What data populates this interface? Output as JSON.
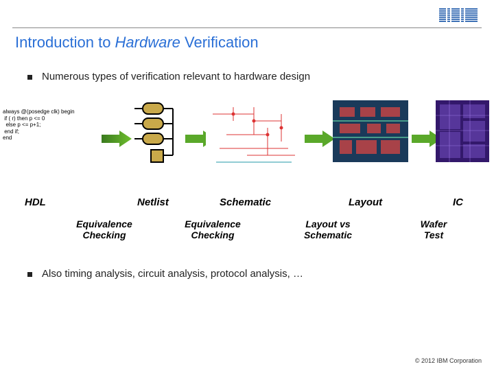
{
  "brand": "IBM",
  "title_prefix": "Introduction to ",
  "title_em": "Hardware",
  "title_suffix": " Verification",
  "bullets": [
    "Numerous types of verification relevant to hardware design",
    "Also timing analysis, circuit analysis, protocol analysis, …"
  ],
  "hdl_code": "always @(posedge clk) begin\n if ( r) then p <= 0\n  else p <= p+1;\n end if;\nend",
  "stages": {
    "hdl": "HDL",
    "netlist": "Netlist",
    "schematic": "Schematic",
    "layout": "Layout",
    "ic": "IC"
  },
  "checks": {
    "eq1": "Equivalence\nChecking",
    "eq2": "Equivalence\nChecking",
    "lvs": "Layout vs\nSchematic",
    "wafer": "Wafer\nTest"
  },
  "copyright": "© 2012 IBM Corporation"
}
